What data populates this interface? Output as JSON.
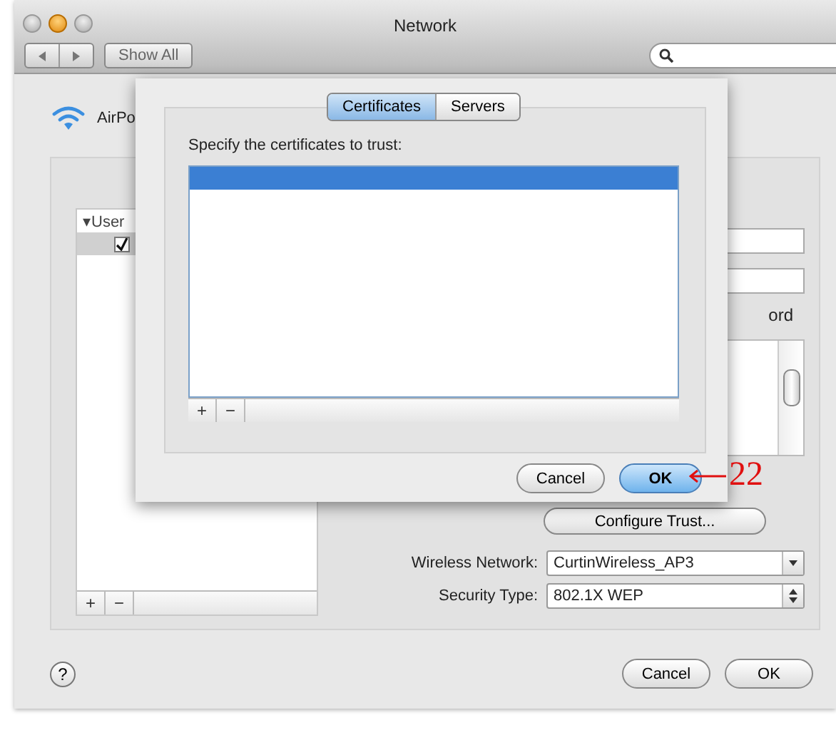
{
  "window": {
    "title": "Network",
    "show_all": "Show All"
  },
  "network_service": {
    "name": "AirPo"
  },
  "left_list": {
    "group": "▾User",
    "items": [
      {
        "checked": true,
        "selected": true
      }
    ],
    "add": "+",
    "remove": "−"
  },
  "right_panel": {
    "cut_label": "ord",
    "configure_trust": "Configure Trust...",
    "fields": [
      {
        "label": "Wireless Network:",
        "value": "CurtinWireless_AP3",
        "kind": "combo"
      },
      {
        "label": "Security Type:",
        "value": "802.1X WEP",
        "kind": "popup"
      }
    ]
  },
  "footer": {
    "help": "?",
    "buttons": [
      {
        "label": "Cancel",
        "default": false
      },
      {
        "label": "OK",
        "default": false
      }
    ]
  },
  "sheet": {
    "tabs": [
      {
        "label": "Certificates",
        "selected": true
      },
      {
        "label": "Servers",
        "selected": false
      }
    ],
    "prompt": "Specify the certificates to trust:",
    "rows": [
      {
        "selected": true
      }
    ],
    "add": "+",
    "remove": "−",
    "buttons": [
      {
        "label": "Cancel",
        "default": false
      },
      {
        "label": "OK",
        "default": true
      }
    ]
  },
  "annotation": {
    "label": "22"
  }
}
